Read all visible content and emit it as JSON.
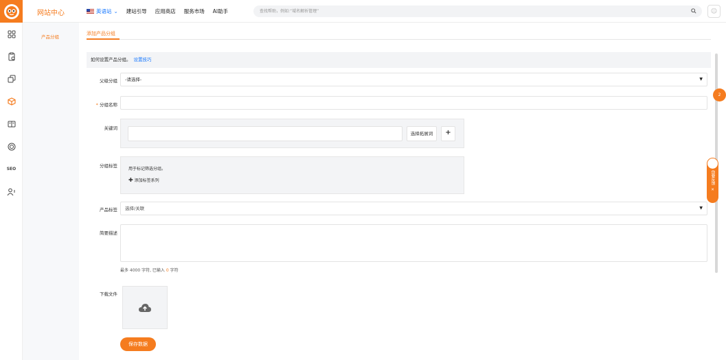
{
  "header": {
    "site_title": "网站中心",
    "lang_label": "英语站",
    "nav": [
      "建站引导",
      "应用商店",
      "服务市场",
      "AI助手"
    ],
    "search_placeholder": "查找帮助，例如:“域名解析管理”"
  },
  "sidebar": {
    "icons": [
      "grid-icon",
      "clipboard-icon",
      "copy-icon",
      "cube-icon",
      "book-icon",
      "badge-icon",
      "seo-icon",
      "users-icon"
    ],
    "active_index": 3
  },
  "subnav": {
    "item": "产品分组"
  },
  "tab": {
    "label": "添加产品分组"
  },
  "help": {
    "text": "如何设置产品分组。",
    "link": "设置技巧"
  },
  "form": {
    "parent_label": "父级分组",
    "parent_value": "-请选择-",
    "name_label": "分组名称",
    "required_mark": "*",
    "keyword_label": "关键词",
    "keyword_button": "选择拓展词",
    "keyword_add": "+",
    "tag_label": "分组标签",
    "tag_hint": "用于标记筛选分组。",
    "tag_add": "添加标签系列",
    "product_tag_label": "产品标签",
    "product_tag_value": "选择/关联",
    "desc_label": "简要描述",
    "desc_note_prefix": "最多 4000 字符, 已输入",
    "desc_count": "0",
    "desc_note_suffix": "字符",
    "file_label": "下载文件",
    "save_label": "保存数据"
  },
  "float": {
    "badge": "2",
    "tab": "你要反馈"
  },
  "colors": {
    "accent": "#f57c1f",
    "link": "#1677ff"
  }
}
